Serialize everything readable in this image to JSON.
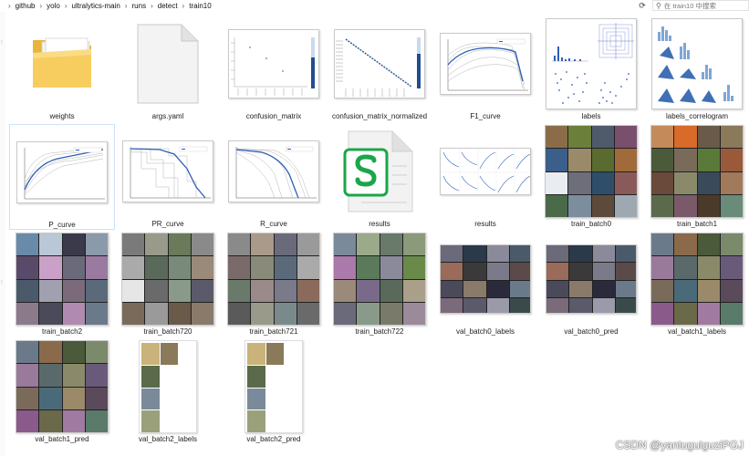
{
  "breadcrumb": [
    "github",
    "yolo",
    "ultralytics-main",
    "runs",
    "detect",
    "train10"
  ],
  "search": {
    "placeholder": "在 train10 中搜索"
  },
  "files": [
    {
      "label": "weights",
      "kind": "folder"
    },
    {
      "label": "args.yaml",
      "kind": "document"
    },
    {
      "label": "confusion_matrix",
      "kind": "matrix"
    },
    {
      "label": "confusion_matrix_normalized",
      "kind": "matrix-normalized"
    },
    {
      "label": "F1_curve",
      "kind": "curve"
    },
    {
      "label": "labels",
      "kind": "labels-plot"
    },
    {
      "label": "labels_correlogram",
      "kind": "correlogram"
    },
    {
      "label": "P_curve",
      "kind": "curve",
      "selected": true
    },
    {
      "label": "PR_curve",
      "kind": "curve-pr"
    },
    {
      "label": "R_curve",
      "kind": "curve-r"
    },
    {
      "label": "results",
      "kind": "spreadsheet"
    },
    {
      "label": "results",
      "kind": "results-plot"
    },
    {
      "label": "train_batch0",
      "kind": "mosaic"
    },
    {
      "label": "train_batch1",
      "kind": "mosaic"
    },
    {
      "label": "train_batch2",
      "kind": "mosaic"
    },
    {
      "label": "train_batch720",
      "kind": "mosaic"
    },
    {
      "label": "train_batch721",
      "kind": "mosaic"
    },
    {
      "label": "train_batch722",
      "kind": "mosaic"
    },
    {
      "label": "val_batch0_labels",
      "kind": "mosaic-wide"
    },
    {
      "label": "val_batch0_pred",
      "kind": "mosaic-wide"
    },
    {
      "label": "val_batch1_labels",
      "kind": "mosaic"
    },
    {
      "label": "val_batch1_pred",
      "kind": "mosaic"
    },
    {
      "label": "val_batch2_labels",
      "kind": "mosaic-narrow"
    },
    {
      "label": "val_batch2_pred",
      "kind": "mosaic-narrow"
    }
  ],
  "watermark": "CSDN @yantuguiguziPGJ",
  "colors": {
    "accent": "#2b5fb7",
    "selection": "#cde3f5",
    "folder": "#f5c95a",
    "spreadsheet": "#1aa64a"
  }
}
